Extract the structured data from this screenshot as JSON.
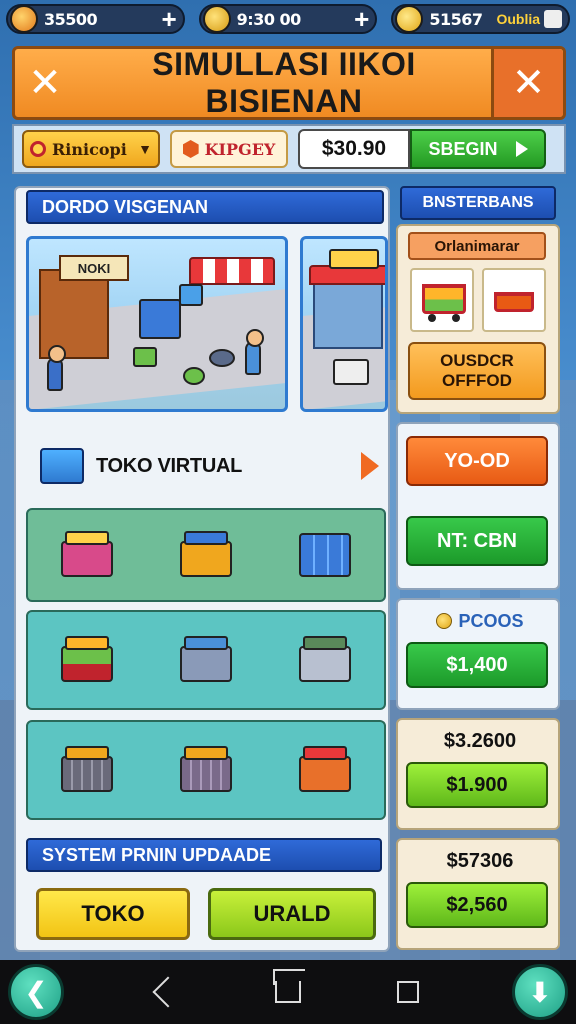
{
  "topbar": {
    "res1": "35500",
    "res2": "9:30 00",
    "res3": "51567",
    "res3_extra": "Oublia"
  },
  "header": {
    "title": "SIMULLASI IIKOI BISIENAN"
  },
  "controls": {
    "dropdown_label": "Rinicopi",
    "chip_label": "KIPGEY",
    "price_value": "$30.90",
    "go_label": "SBEGIN"
  },
  "main": {
    "section_title": "DORDO VISGENAN",
    "scene_sign_1": "NOKI",
    "toko_label": "TOKO VIRTUAL",
    "system_title": "SYSTEM PRNIN UPDAADE",
    "btn_left": "TOKO",
    "btn_right": "URALD"
  },
  "sidebar": {
    "title": "BNSTERBANS",
    "card_title": "Orlanimarar",
    "card_button": "OUSDCR OFFFOD",
    "btn_orange": "YO-OD",
    "btn_green": "NT: CBN",
    "promo_label": "PCOOS",
    "promo_price": "$1,400",
    "price_a": "$3.2600",
    "price_a_btn": "$1.900",
    "price_b": "$57306",
    "price_b_btn": "$2,560"
  },
  "colors": {
    "title_orange": "#f08a22",
    "header_blue": "#1d4eb0",
    "go_green": "#239a23",
    "accent_lime": "#8bc81a"
  }
}
